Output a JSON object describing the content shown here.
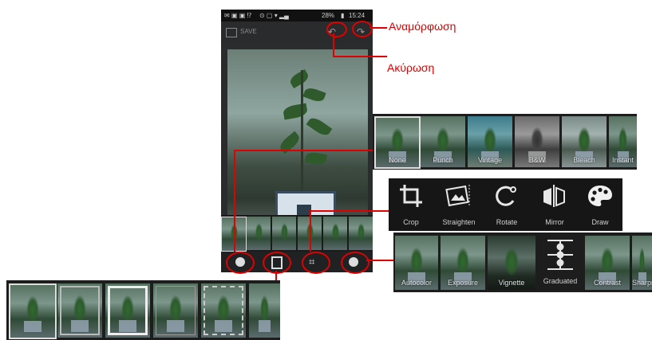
{
  "annotations": {
    "redo_label": "Αναμόρφωση",
    "undo_label": "Ακύρωση"
  },
  "phone": {
    "status": {
      "percent": "28%",
      "time": "15:24"
    },
    "actionbar": {
      "title": "SAVE"
    }
  },
  "filters_panel": {
    "items": [
      "None",
      "Punch",
      "Vintage",
      "B&W",
      "Bleach",
      "Instant"
    ]
  },
  "geometry_panel": {
    "items": [
      {
        "label": "Crop",
        "icon": "crop-icon"
      },
      {
        "label": "Straighten",
        "icon": "straighten-icon"
      },
      {
        "label": "Rotate",
        "icon": "rotate-icon"
      },
      {
        "label": "Mirror",
        "icon": "mirror-icon"
      },
      {
        "label": "Draw",
        "icon": "draw-palette-icon"
      }
    ]
  },
  "adjust_panel": {
    "items": [
      "Autocolor",
      "Exposure",
      "Vignette",
      "Graduated",
      "Contrast",
      "Sharpness"
    ]
  },
  "frames_panel": {
    "count": 6
  },
  "colors": {
    "annotation": "#e00000",
    "panel_bg": "#1d1d1d"
  }
}
